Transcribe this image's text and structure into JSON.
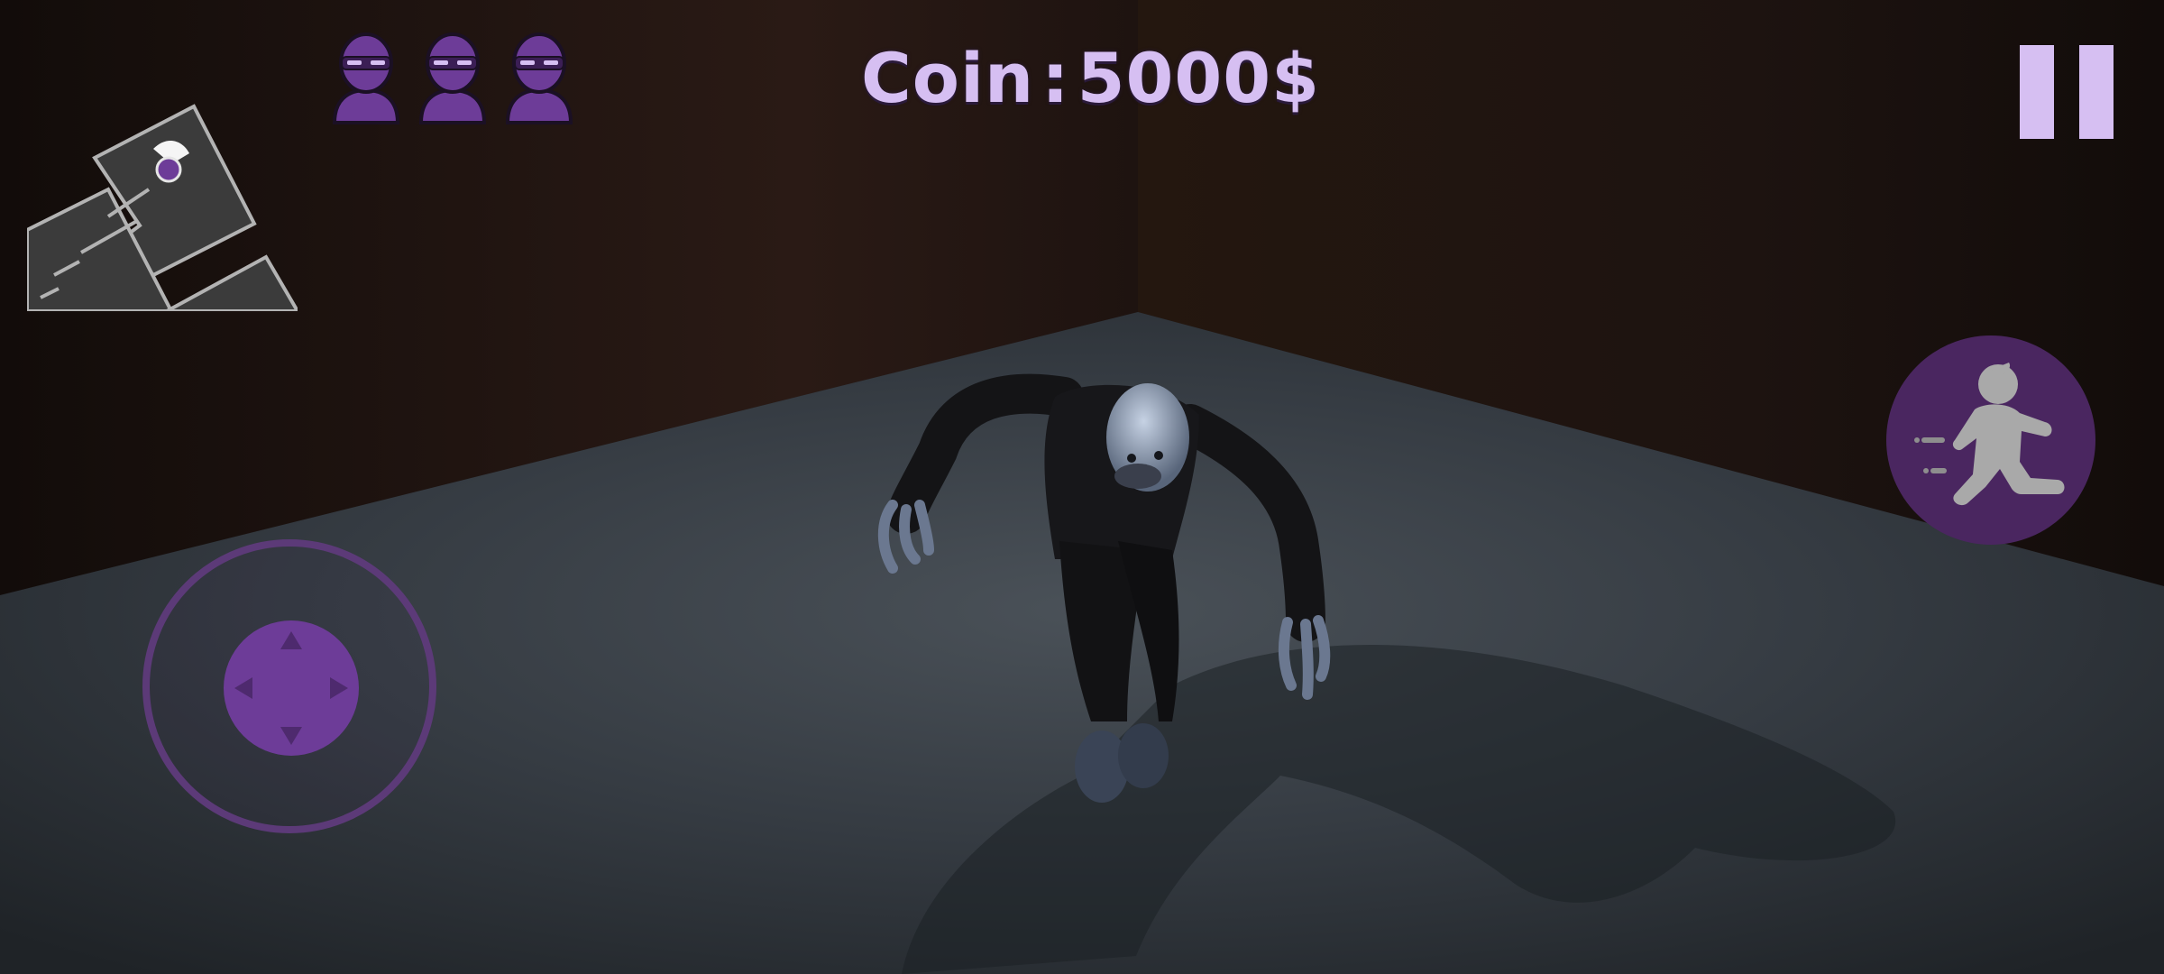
{
  "hud": {
    "coin_label": "Coin",
    "coin_separator": ":",
    "coin_value": "5000$",
    "lives_remaining": 3
  },
  "icons": {
    "life": "ninja-head-icon",
    "pause": "pause-icon",
    "sprint": "running-man-icon",
    "player_marker": "player-location-icon"
  },
  "colors": {
    "hud_text": "#d6bff2",
    "accent_purple": "#6d3c98",
    "sprint_bg": "#4a2660",
    "joystick_ring": "#5c3a78"
  }
}
